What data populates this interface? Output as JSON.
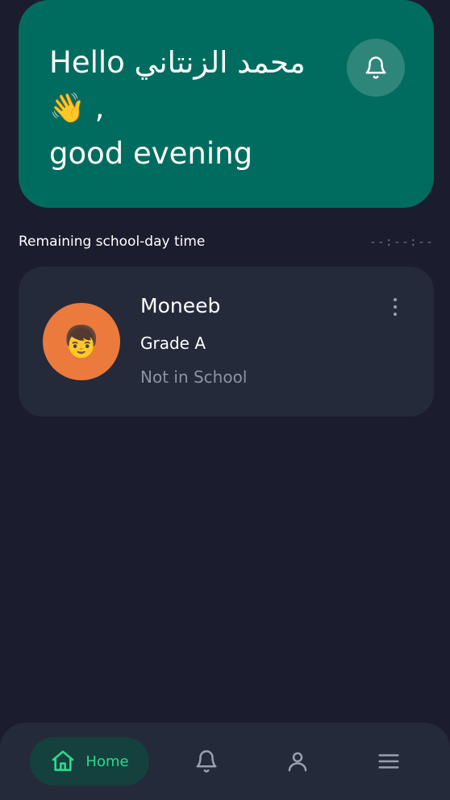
{
  "header": {
    "greeting_line1": "Hello محمد الزنتاني",
    "wave_emoji": "👋",
    "greeting_comma": ",",
    "greeting_line2": "good evening",
    "notification_icon": "bell-icon"
  },
  "section": {
    "label": "Remaining school-day time",
    "time": "--:--:--"
  },
  "student": {
    "avatar_emoji": "👦",
    "name": "Moneeb",
    "grade": "Grade A",
    "status": "Not in School",
    "more_icon": "more-vertical-icon"
  },
  "bottom_nav": {
    "items": [
      {
        "label": "Home",
        "icon": "home-icon",
        "active": true
      },
      {
        "label": "",
        "icon": "bell-icon",
        "active": false
      },
      {
        "label": "",
        "icon": "user-icon",
        "active": false
      },
      {
        "label": "",
        "icon": "menu-icon",
        "active": false
      }
    ]
  },
  "colors": {
    "background": "#1c1c2f",
    "header_card": "#006c5f",
    "student_card": "#242a3a",
    "avatar": "#ec7a3c",
    "accent_green": "#2bd891",
    "nav_active_bg": "#14413d"
  }
}
